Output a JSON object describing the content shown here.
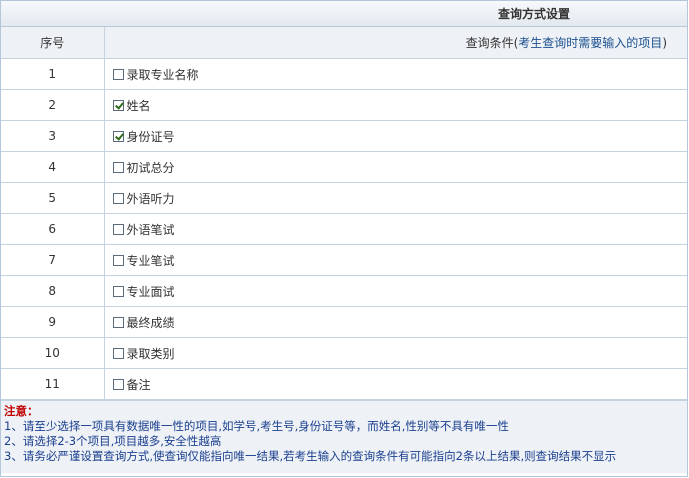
{
  "panel": {
    "title": "查询方式设置"
  },
  "table": {
    "header": {
      "num": "序号",
      "cond_prefix": "查询条件(",
      "cond_hint": "考生查询时需要输入的项目",
      "cond_suffix": ")"
    },
    "rows": [
      {
        "num": "1",
        "label": "录取专业名称",
        "checked": false
      },
      {
        "num": "2",
        "label": "姓名",
        "checked": true
      },
      {
        "num": "3",
        "label": "身份证号",
        "checked": true
      },
      {
        "num": "4",
        "label": "初试总分",
        "checked": false
      },
      {
        "num": "5",
        "label": "外语听力",
        "checked": false
      },
      {
        "num": "6",
        "label": "外语笔试",
        "checked": false
      },
      {
        "num": "7",
        "label": "专业笔试",
        "checked": false
      },
      {
        "num": "8",
        "label": "专业面试",
        "checked": false
      },
      {
        "num": "9",
        "label": "最终成绩",
        "checked": false
      },
      {
        "num": "10",
        "label": "录取类别",
        "checked": false
      },
      {
        "num": "11",
        "label": "备注",
        "checked": false
      }
    ]
  },
  "notes": {
    "title": "注意：",
    "lines": [
      "1、请至少选择一项具有数据唯一性的项目,如学号,考生号,身份证号等，而姓名,性别等不具有唯一性",
      "2、请选择2-3个项目,项目越多,安全性越高",
      "3、请务必严谨设置查询方式,使查询仅能指向唯一结果,若考生输入的查询条件有可能指向2条以上结果,则查询结果不显示"
    ]
  },
  "colors": {
    "hint_blue": "#1b4f8f",
    "note_red": "#c00000",
    "header_bg": "#eef2f6",
    "border": "#c6d3df"
  }
}
